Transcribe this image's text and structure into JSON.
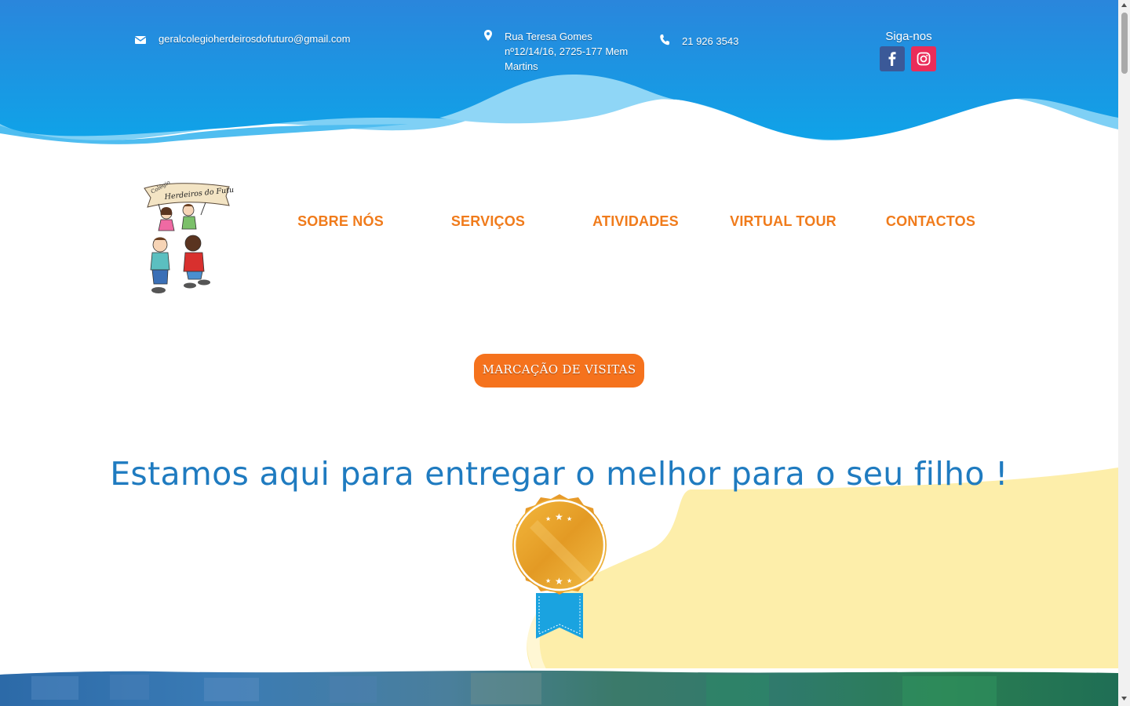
{
  "header": {
    "email": "geralcolegioherdeirosdofuturo@gmail.com",
    "address": "Rua Teresa Gomes nº12/14/16, 2725-177 Mem Martins",
    "phone": "21 926 3543",
    "social_label": "Siga-nos",
    "social": [
      "facebook",
      "instagram"
    ]
  },
  "logo": {
    "banner_text_small": "Colégio",
    "banner_text": "Herdeiros do Futuro"
  },
  "nav": {
    "items": [
      "SOBRE NÓS",
      "SERVIÇOS",
      "ATIVIDADES",
      "VIRTUAL TOUR",
      "CONTACTOS"
    ]
  },
  "cta": {
    "label": "MARCAÇÃO DE VISITAS"
  },
  "hero": {
    "headline": "Estamos aqui para entregar o melhor para o seu filho !"
  },
  "colors": {
    "header_blue": "#1f8fe0",
    "wave_light": "#7fd0f5",
    "nav_orange": "#f07b1b",
    "cta_orange": "#f5721d",
    "headline_blue": "#1f7bc0",
    "blob_yellow": "#fdeeaa",
    "medal_gold": "#eba52e",
    "ribbon_blue": "#1aa3e0"
  },
  "icons": {
    "email": "envelope-icon",
    "address": "map-pin-icon",
    "phone": "phone-icon",
    "facebook": "facebook-icon",
    "instagram": "instagram-icon",
    "medal": "award-medal-icon"
  }
}
